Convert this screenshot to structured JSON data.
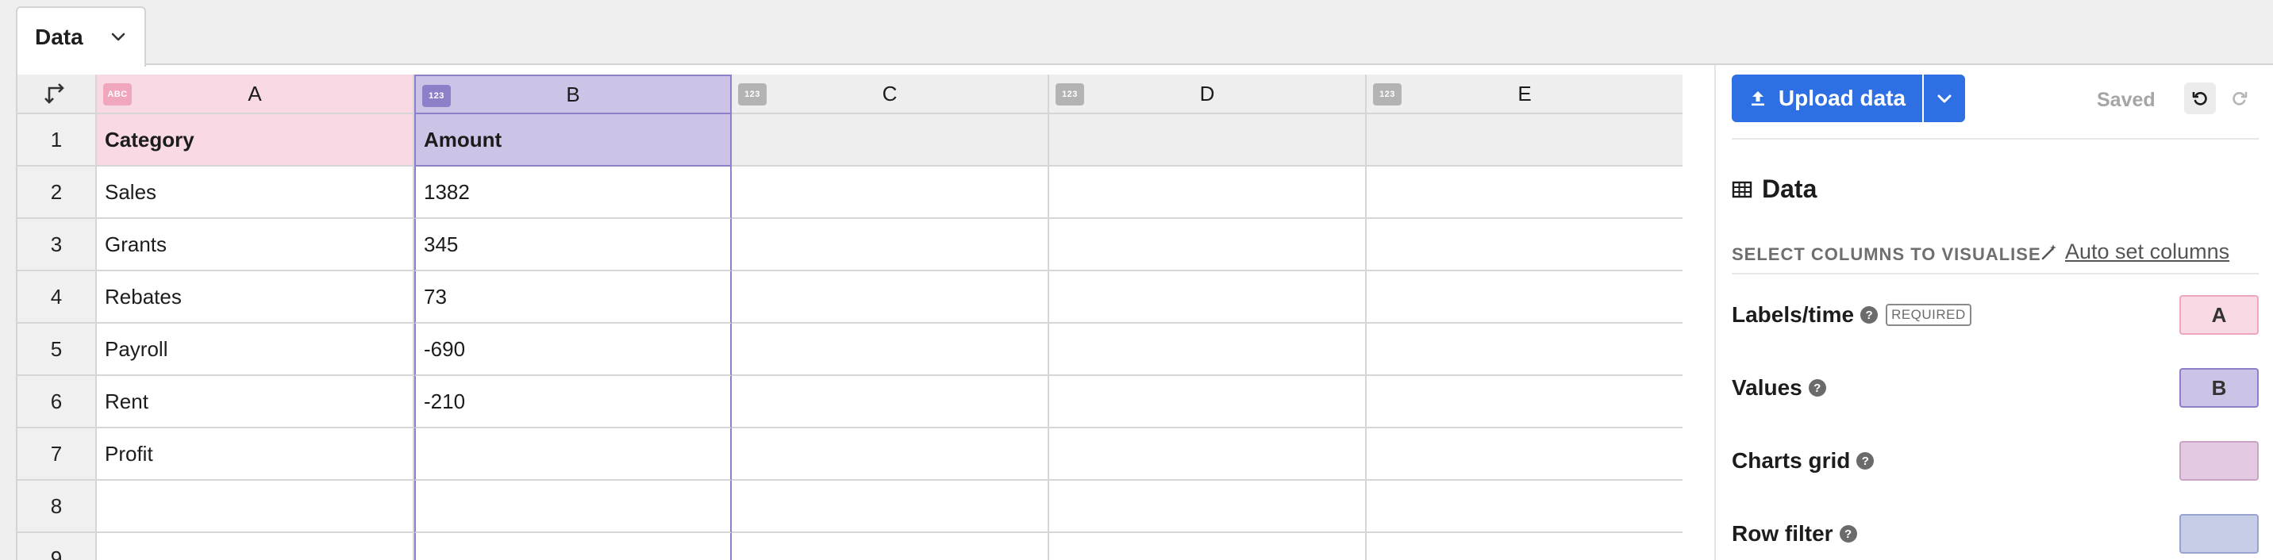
{
  "tab": {
    "label": "Data",
    "icon": "chevron-down-icon"
  },
  "grid": {
    "columns": [
      {
        "letter": "A",
        "type": "ABC"
      },
      {
        "letter": "B",
        "type": "123"
      },
      {
        "letter": "C",
        "type": "123"
      },
      {
        "letter": "D",
        "type": "123"
      },
      {
        "letter": "E",
        "type": "123"
      }
    ],
    "rows": [
      {
        "num": "1",
        "a": "Category",
        "b": "Amount"
      },
      {
        "num": "2",
        "a": "Sales",
        "b": "1382"
      },
      {
        "num": "3",
        "a": "Grants",
        "b": "345"
      },
      {
        "num": "4",
        "a": "Rebates",
        "b": "73"
      },
      {
        "num": "5",
        "a": "Payroll",
        "b": "-690"
      },
      {
        "num": "6",
        "a": "Rent",
        "b": "-210"
      },
      {
        "num": "7",
        "a": "Profit",
        "b": ""
      },
      {
        "num": "8",
        "a": "",
        "b": ""
      },
      {
        "num": "9",
        "a": "",
        "b": ""
      }
    ]
  },
  "sidebar": {
    "upload_label": "Upload data",
    "saved_label": "Saved",
    "data_heading": "Data",
    "select_label": "SELECT COLUMNS TO VISUALISE",
    "auto_set_label": "Auto set columns",
    "bindings": {
      "labels": {
        "label": "Labels/time",
        "required": "REQUIRED",
        "column": "A"
      },
      "values": {
        "label": "Values",
        "column": "B"
      },
      "charts_grid": {
        "label": "Charts grid",
        "column": ""
      },
      "row_filter": {
        "label": "Row filter",
        "column": ""
      }
    }
  },
  "colors": {
    "accent": "#2f6fe4",
    "col_a": "#f9d9e3",
    "col_b": "#cdc3e6"
  }
}
